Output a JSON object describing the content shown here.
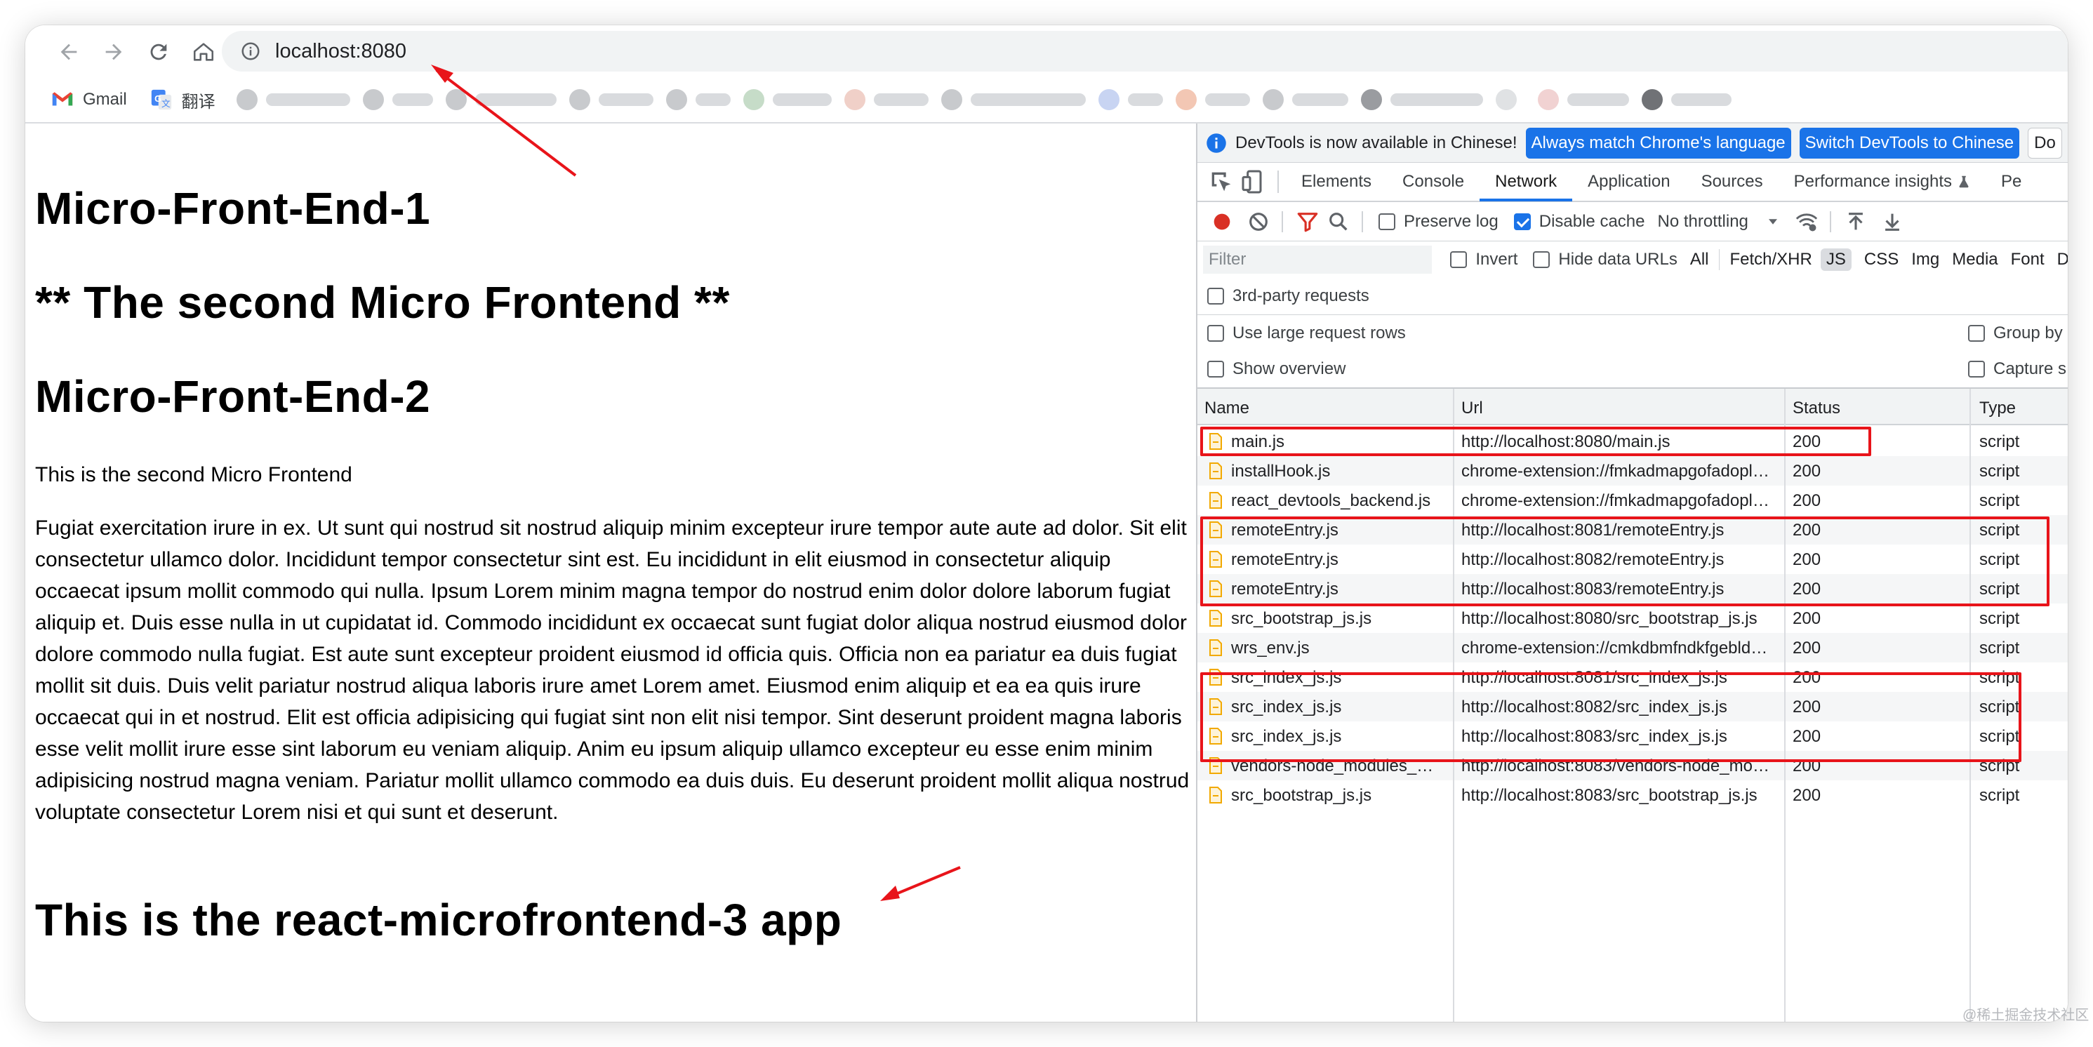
{
  "browser": {
    "url": "localhost:8080",
    "bookmarks": [
      {
        "label": "Gmail"
      },
      {
        "label": "翻译"
      }
    ]
  },
  "page": {
    "heading1": "Micro-Front-End-1",
    "heading2": "** The second Micro Frontend **",
    "heading3": "Micro-Front-End-2",
    "subtitle": "This is the second Micro Frontend",
    "paragraph": "Fugiat exercitation irure in ex. Ut sunt qui nostrud sit nostrud aliquip minim excepteur irure tempor aute aute ad dolor. Sit elit consectetur ullamco dolor. Incididunt tempor consectetur sint est. Eu incididunt in elit eiusmod in consectetur aliquip occaecat ipsum mollit commodo qui nulla. Ipsum Lorem minim magna tempor do nostrud enim dolor dolore laborum fugiat aliquip et. Duis esse nulla in ut cupidatat id. Commodo incididunt ex occaecat sunt fugiat dolor aliqua nostrud eiusmod dolor dolore commodo nulla fugiat. Est aute sunt excepteur proident eiusmod id officia quis. Officia non ea pariatur ea duis fugiat mollit sit duis. Duis velit pariatur nostrud aliqua laboris irure amet Lorem amet. Eiusmod enim aliquip et ea ea quis irure occaecat qui in et nostrud. Elit est officia adipisicing qui fugiat sint non elit nisi tempor. Sint deserunt proident magna laboris esse velit mollit irure esse sint laborum eu veniam aliquip. Anim eu ipsum aliquip ullamco excepteur eu esse enim minim adipisicing nostrud magna veniam. Pariatur mollit ullamco commodo ea duis duis. Eu deserunt proident mollit aliqua nostrud voluptate consectetur Lorem nisi et qui sunt et deserunt.",
    "heading4": "This is the react-microfrontend-3 app"
  },
  "devtools": {
    "infobar": {
      "message": "DevTools is now available in Chinese!",
      "btn_match": "Always match Chrome's language",
      "btn_switch": "Switch DevTools to Chinese",
      "btn_more": "Do"
    },
    "tabs": [
      "Elements",
      "Console",
      "Network",
      "Application",
      "Sources",
      "Performance insights",
      "Pe"
    ],
    "active_tab": "Network",
    "controls": {
      "preserve_log": "Preserve log",
      "disable_cache": "Disable cache",
      "throttling": "No throttling"
    },
    "filter": {
      "placeholder": "Filter",
      "invert": "Invert",
      "hide_data_urls": "Hide data URLs",
      "types": [
        "All",
        "Fetch/XHR",
        "JS",
        "CSS",
        "Img",
        "Media",
        "Font",
        "D"
      ],
      "active_type": "JS"
    },
    "options": {
      "third_party": "3rd-party requests",
      "large_rows": "Use large request rows",
      "show_overview": "Show overview",
      "group_by": "Group by",
      "capture": "Capture s"
    },
    "columns": {
      "name": "Name",
      "url": "Url",
      "status": "Status",
      "type": "Type"
    },
    "requests": [
      {
        "name": "main.js",
        "url": "http://localhost:8080/main.js",
        "status": "200",
        "type": "script"
      },
      {
        "name": "installHook.js",
        "url": "chrome-extension://fmkadmapgofadopl…",
        "status": "200",
        "type": "script"
      },
      {
        "name": "react_devtools_backend.js",
        "url": "chrome-extension://fmkadmapgofadopl…",
        "status": "200",
        "type": "script"
      },
      {
        "name": "remoteEntry.js",
        "url": "http://localhost:8081/remoteEntry.js",
        "status": "200",
        "type": "script"
      },
      {
        "name": "remoteEntry.js",
        "url": "http://localhost:8082/remoteEntry.js",
        "status": "200",
        "type": "script"
      },
      {
        "name": "remoteEntry.js",
        "url": "http://localhost:8083/remoteEntry.js",
        "status": "200",
        "type": "script"
      },
      {
        "name": "src_bootstrap_js.js",
        "url": "http://localhost:8080/src_bootstrap_js.js",
        "status": "200",
        "type": "script"
      },
      {
        "name": "wrs_env.js",
        "url": "chrome-extension://cmkdbmfndkfgebld…",
        "status": "200",
        "type": "script"
      },
      {
        "name": "src_index_js.js",
        "url": "http://localhost:8081/src_index_js.js",
        "status": "200",
        "type": "script"
      },
      {
        "name": "src_index_js.js",
        "url": "http://localhost:8082/src_index_js.js",
        "status": "200",
        "type": "script"
      },
      {
        "name": "src_index_js.js",
        "url": "http://localhost:8083/src_index_js.js",
        "status": "200",
        "type": "script"
      },
      {
        "name": "vendors-node_modules_…",
        "url": "http://localhost:8083/vendors-node_mo…",
        "status": "200",
        "type": "script"
      },
      {
        "name": "src_bootstrap_js.js",
        "url": "http://localhost:8083/src_bootstrap_js.js",
        "status": "200",
        "type": "script"
      }
    ]
  },
  "watermark": "@稀土掘金技术社区",
  "colors": {
    "accent": "#1a73e8",
    "annotation": "#e8141a"
  }
}
